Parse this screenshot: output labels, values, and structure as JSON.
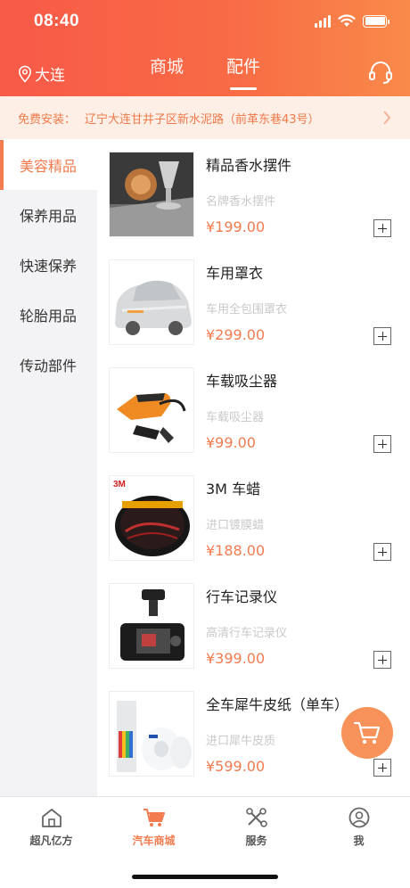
{
  "status_bar": {
    "time": "08:40"
  },
  "header": {
    "location": "大连",
    "tabs": [
      {
        "label": "商城",
        "active": false
      },
      {
        "label": "配件",
        "active": true
      }
    ],
    "service_icon": "headset-icon"
  },
  "notice": {
    "label": "免费安装：",
    "address": "辽宁大连甘井子区新水泥路（前革东巷43号）"
  },
  "sidebar": {
    "items": [
      {
        "label": "美容精品",
        "active": true
      },
      {
        "label": "保养用品",
        "active": false
      },
      {
        "label": "快速保养",
        "active": false
      },
      {
        "label": "轮胎用品",
        "active": false
      },
      {
        "label": "传动部件",
        "active": false
      }
    ]
  },
  "products": [
    {
      "name": "精品香水摆件",
      "desc": "名牌香水摆件",
      "price": "¥199.00",
      "image": "perfume-ornament-image"
    },
    {
      "name": "车用罩衣",
      "desc": "车用全包围罩衣",
      "price": "¥299.00",
      "image": "car-cover-image"
    },
    {
      "name": "车载吸尘器",
      "desc": "车载吸尘器",
      "price": "¥99.00",
      "image": "vacuum-cleaner-image"
    },
    {
      "name": "3M 车蜡",
      "desc": "进口镀膜蜡",
      "price": "¥188.00",
      "image": "car-wax-image"
    },
    {
      "name": "行车记录仪",
      "desc": "高清行车记录仪",
      "price": "¥399.00",
      "image": "dashcam-image"
    },
    {
      "name": "全车犀牛皮纸（单车）",
      "desc": "进口犀牛皮质",
      "price": "¥599.00",
      "image": "ppf-film-image"
    }
  ],
  "thumb_text": {
    "brand_3m": "3M"
  },
  "tabbar": {
    "items": [
      {
        "label": "超凡亿方",
        "icon": "home-icon",
        "active": false
      },
      {
        "label": "汽车商城",
        "icon": "cart-icon",
        "active": true
      },
      {
        "label": "服务",
        "icon": "tools-icon",
        "active": false
      },
      {
        "label": "我",
        "icon": "user-icon",
        "active": false
      }
    ]
  },
  "colors": {
    "accent": "#f27c4f",
    "header_start": "#f85a48",
    "header_end": "#f98a4a",
    "notice_bg": "#fdeee6",
    "cart_fab": "#f7935a"
  }
}
